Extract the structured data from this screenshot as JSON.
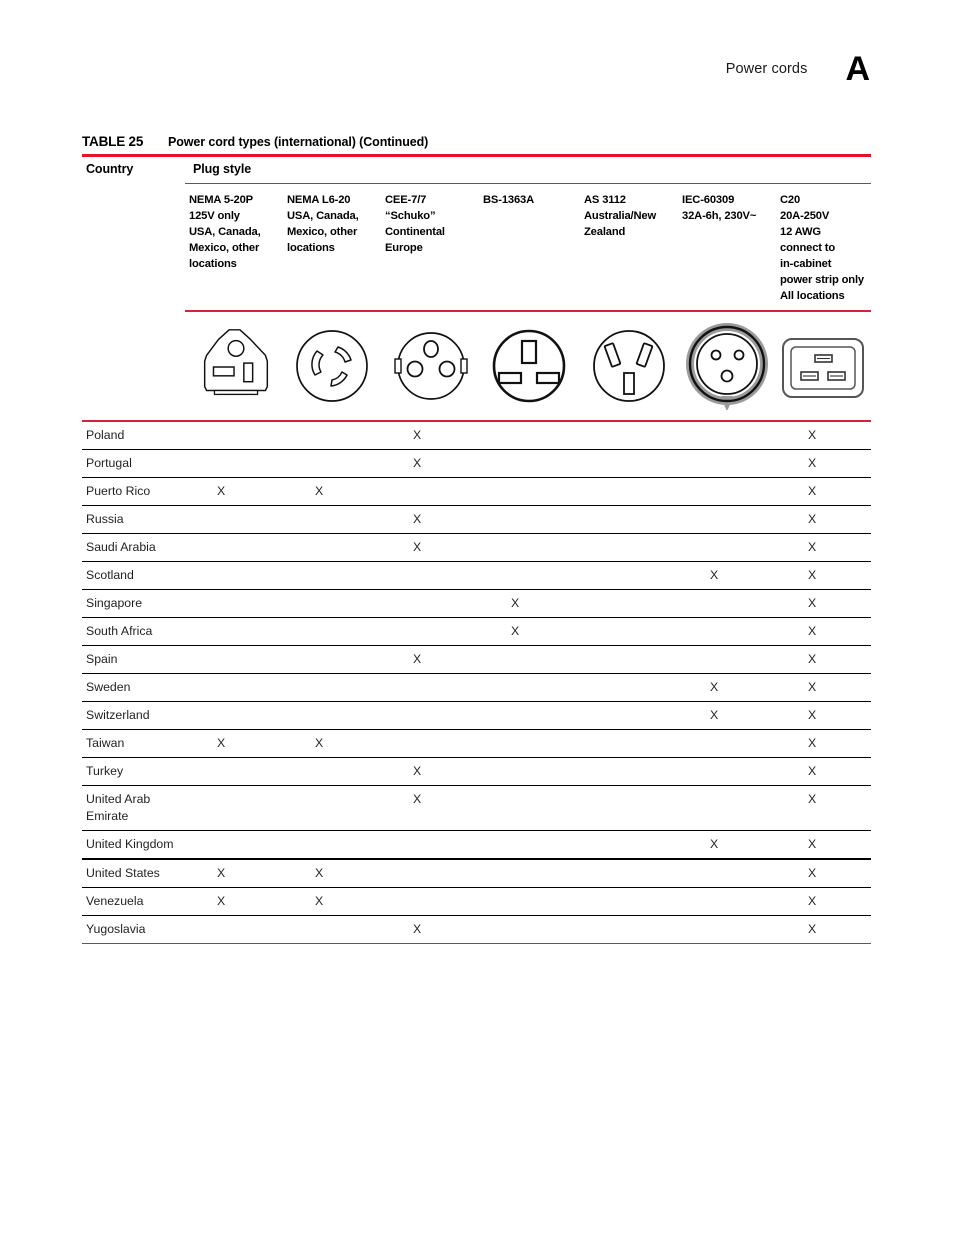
{
  "header": {
    "title": "Power cords",
    "appendix": "A"
  },
  "table": {
    "label": "TABLE 25",
    "caption": "Power cord types (international) (Continued)",
    "country_header": "Country",
    "plug_style_header": "Plug style",
    "accent_color": "#e8112d",
    "columns": [
      {
        "id": "nema-5-20p",
        "lines": [
          "NEMA 5-20P",
          "125V only",
          "USA, Canada,",
          "Mexico, other",
          "locations"
        ],
        "icon": "nema-5-20p-plug-icon"
      },
      {
        "id": "nema-l6-20",
        "lines": [
          "NEMA L6-20",
          "USA, Canada,",
          "Mexico, other",
          "locations"
        ],
        "icon": "nema-l6-20-plug-icon"
      },
      {
        "id": "cee-7-7",
        "lines": [
          "CEE-7/7",
          "“Schuko”",
          "Continental",
          "Europe"
        ],
        "icon": "cee-7-7-schuko-plug-icon"
      },
      {
        "id": "bs-1363a",
        "lines": [
          "BS-1363A"
        ],
        "icon": "bs-1363a-plug-icon"
      },
      {
        "id": "as-3112",
        "lines": [
          "AS 3112",
          "Australia/New",
          "Zealand"
        ],
        "icon": "as-3112-plug-icon"
      },
      {
        "id": "iec-60309",
        "lines": [
          "IEC-60309",
          "32A-6h, 230V~"
        ],
        "icon": "iec-60309-plug-icon"
      },
      {
        "id": "c20",
        "lines": [
          "C20",
          "20A-250V",
          "12 AWG",
          "connect to",
          "in-cabinet",
          "power strip only",
          "All locations"
        ],
        "icon": "c20-connector-icon"
      }
    ],
    "mark": "X",
    "rows": [
      {
        "country": "Poland",
        "marks": [
          false,
          false,
          true,
          false,
          false,
          false,
          true
        ]
      },
      {
        "country": "Portugal",
        "marks": [
          false,
          false,
          true,
          false,
          false,
          false,
          true
        ]
      },
      {
        "country": "Puerto Rico",
        "marks": [
          true,
          true,
          false,
          false,
          false,
          false,
          true
        ]
      },
      {
        "country": "Russia",
        "marks": [
          false,
          false,
          true,
          false,
          false,
          false,
          true
        ]
      },
      {
        "country": "Saudi Arabia",
        "marks": [
          false,
          false,
          true,
          false,
          false,
          false,
          true
        ]
      },
      {
        "country": "Scotland",
        "marks": [
          false,
          false,
          false,
          false,
          false,
          true,
          true
        ]
      },
      {
        "country": "Singapore",
        "marks": [
          false,
          false,
          false,
          true,
          false,
          false,
          true
        ]
      },
      {
        "country": "South Africa",
        "marks": [
          false,
          false,
          false,
          true,
          false,
          false,
          true
        ]
      },
      {
        "country": "Spain",
        "marks": [
          false,
          false,
          true,
          false,
          false,
          false,
          true
        ]
      },
      {
        "country": "Sweden",
        "marks": [
          false,
          false,
          false,
          false,
          false,
          true,
          true
        ]
      },
      {
        "country": "Switzerland",
        "marks": [
          false,
          false,
          false,
          false,
          false,
          true,
          true
        ]
      },
      {
        "country": "Taiwan",
        "marks": [
          true,
          true,
          false,
          false,
          false,
          false,
          true
        ]
      },
      {
        "country": "Turkey",
        "marks": [
          false,
          false,
          true,
          false,
          false,
          false,
          true
        ]
      },
      {
        "country": "United Arab\nEmirate",
        "marks": [
          false,
          false,
          true,
          false,
          false,
          false,
          true
        ]
      },
      {
        "country": "United Kingdom",
        "marks": [
          false,
          false,
          false,
          false,
          false,
          true,
          true
        ]
      },
      {
        "country": "United States",
        "marks": [
          true,
          true,
          false,
          false,
          false,
          false,
          true
        ]
      },
      {
        "country": "Venezuela",
        "marks": [
          true,
          true,
          false,
          false,
          false,
          false,
          true
        ]
      },
      {
        "country": "Yugoslavia",
        "marks": [
          false,
          false,
          true,
          false,
          false,
          false,
          true
        ]
      }
    ]
  }
}
